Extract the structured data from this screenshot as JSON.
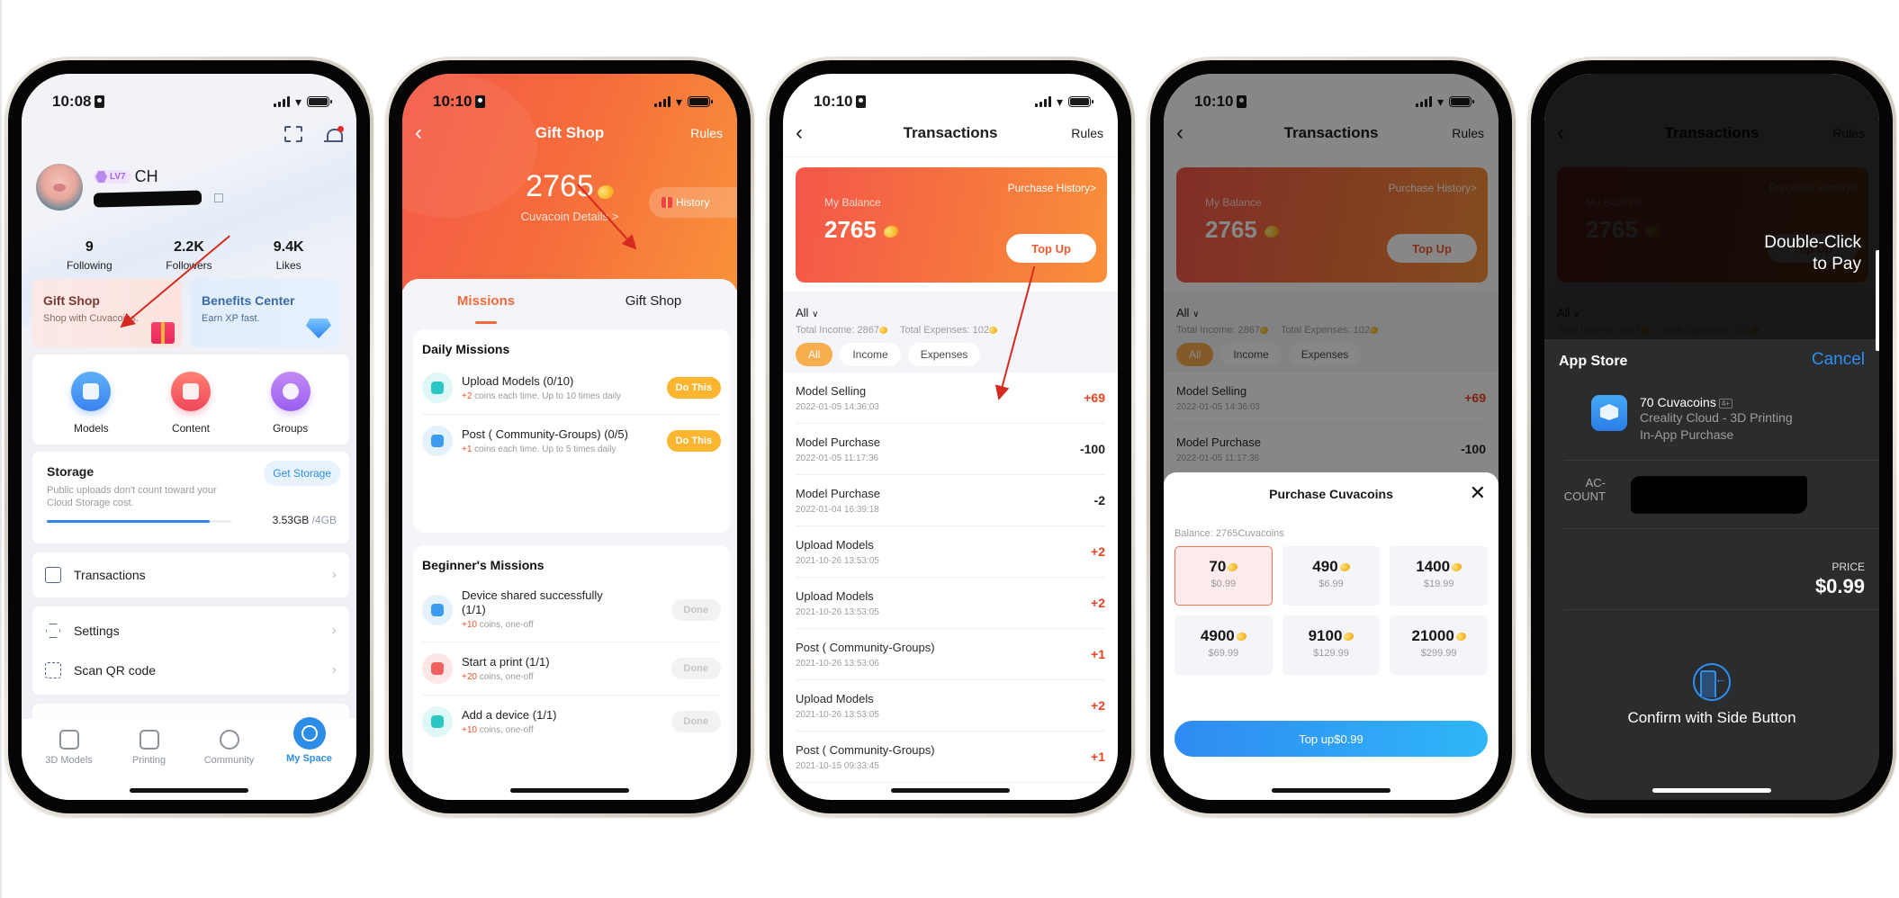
{
  "phone1": {
    "status_time": "10:08",
    "user": {
      "level": "LV7",
      "name": "CH"
    },
    "stats": [
      {
        "value": "9",
        "label": "Following"
      },
      {
        "value": "2.2K",
        "label": "Followers"
      },
      {
        "value": "9.4K",
        "label": "Likes"
      }
    ],
    "promos": {
      "gift_shop": {
        "title": "Gift Shop",
        "subtitle": "Shop with Cuvacoins."
      },
      "benefits": {
        "title": "Benefits Center",
        "subtitle": "Earn XP fast."
      }
    },
    "tools": [
      {
        "label": "Models",
        "icon": "cube-icon"
      },
      {
        "label": "Content",
        "icon": "document-icon"
      },
      {
        "label": "Groups",
        "icon": "planet-icon"
      }
    ],
    "storage": {
      "title": "Storage",
      "description": "Public uploads don't count toward your Cloud Storage cost.",
      "button": "Get Storage",
      "used": "3.53GB",
      "total": " /4GB",
      "used_fraction": 0.8825
    },
    "menu": [
      {
        "label": "Transactions",
        "icon": "transactions-icon"
      },
      {
        "label": "Settings",
        "icon": "settings-icon"
      },
      {
        "label": "Scan QR code",
        "icon": "scan-icon"
      }
    ],
    "tabbar": [
      {
        "label": "3D Models",
        "active": false
      },
      {
        "label": "Printing",
        "active": false
      },
      {
        "label": "Community",
        "active": false
      },
      {
        "label": "My Space",
        "active": true
      }
    ]
  },
  "phone2": {
    "status_time": "10:10",
    "title": "Gift Shop",
    "rules": "Rules",
    "balance": "2765",
    "details_link": "Cuvacoin Details  >",
    "history": "History",
    "tabs": [
      "Missions",
      "Gift Shop"
    ],
    "daily": {
      "title": "Daily Missions",
      "items": [
        {
          "title": "Upload Models (0/10)",
          "reward": "+2",
          "desc": " coins each time. Up to 10 times daily",
          "action": "Do This",
          "icon": "hexagons-icon"
        },
        {
          "title": "Post ( Community-Groups) (0/5)",
          "reward": "+1",
          "desc": " coins each time. Up to 5 times daily",
          "action": "Do This",
          "icon": "edit-icon"
        }
      ]
    },
    "beginner": {
      "title": "Beginner's Missions",
      "items": [
        {
          "title": "Device shared successfully (1/1)",
          "reward": "+10",
          "desc": " coins, one-off",
          "action": "Done",
          "icon": "share-user-icon"
        },
        {
          "title": "Start a print (1/1)",
          "reward": "+20",
          "desc": " coins, one-off",
          "action": "Done",
          "icon": "printer-icon"
        },
        {
          "title": "Add a device (1/1)",
          "reward": "+10",
          "desc": " coins, one-off",
          "action": "Done",
          "icon": "device-icon"
        }
      ]
    }
  },
  "transactions": {
    "status_time": "10:10",
    "title": "Transactions",
    "rules": "Rules",
    "my_balance_label": "My Balance",
    "balance": "2765",
    "purchase_history": "Purchase History>",
    "top_up": "Top Up",
    "filter": "All",
    "total_income": "Total Income: 2867",
    "total_expenses": "Total Expenses: 102",
    "chips": [
      "All",
      "Income",
      "Expenses"
    ],
    "rows": [
      {
        "name": "Model Selling",
        "date": "2022-01-05 14:36:03",
        "amount": "+69",
        "positive": true
      },
      {
        "name": "Model Purchase",
        "date": "2022-01-05 11:17:36",
        "amount": "-100",
        "positive": false
      },
      {
        "name": "Model Purchase",
        "date": "2022-01-04 16:39:18",
        "amount": "-2",
        "positive": false
      },
      {
        "name": "Upload Models",
        "date": "2021-10-26 13:53:05",
        "amount": "+2",
        "positive": true
      },
      {
        "name": "Upload Models",
        "date": "2021-10-26 13:53:05",
        "amount": "+2",
        "positive": true
      },
      {
        "name": "Post ( Community-Groups)",
        "date": "2021-10-26 13:53:06",
        "amount": "+1",
        "positive": true
      },
      {
        "name": "Upload Models",
        "date": "2021-10-26 13:53:05",
        "amount": "+2",
        "positive": true
      },
      {
        "name": "Post ( Community-Groups)",
        "date": "2021-10-15 09:33:45",
        "amount": "+1",
        "positive": true
      }
    ]
  },
  "purchase_sheet": {
    "title": "Purchase Cuvacoins",
    "balance": "Balance:  2765Cuvacoins",
    "packs": [
      {
        "coins": "70",
        "price": "$0.99",
        "selected": true
      },
      {
        "coins": "490",
        "price": "$6.99",
        "selected": false
      },
      {
        "coins": "1400",
        "price": "$19.99",
        "selected": false
      },
      {
        "coins": "4900",
        "price": "$69.99",
        "selected": false
      },
      {
        "coins": "9100",
        "price": "$129.99",
        "selected": false
      },
      {
        "coins": "21000",
        "price": "$299.99",
        "selected": false
      }
    ],
    "button": "Top up$0.99"
  },
  "app_store": {
    "hint": [
      "Double-Click",
      "to Pay"
    ],
    "header": "App Store",
    "cancel": "Cancel",
    "item_name": "70 Cuvacoins",
    "age_rating": "4+",
    "app_name": "Creality Cloud - 3D Printing",
    "item_type": "In-App Purchase",
    "account_label": [
      "AC-",
      "COUNT"
    ],
    "price_label": "PRICE",
    "price": "$0.99",
    "confirm": "Confirm with Side Button"
  },
  "colors": {
    "accent_orange": "#f26a3c",
    "accent_blue": "#2d8ce6",
    "positive_red": "#f0421f",
    "annotation_arrow": "#d42a1f"
  }
}
